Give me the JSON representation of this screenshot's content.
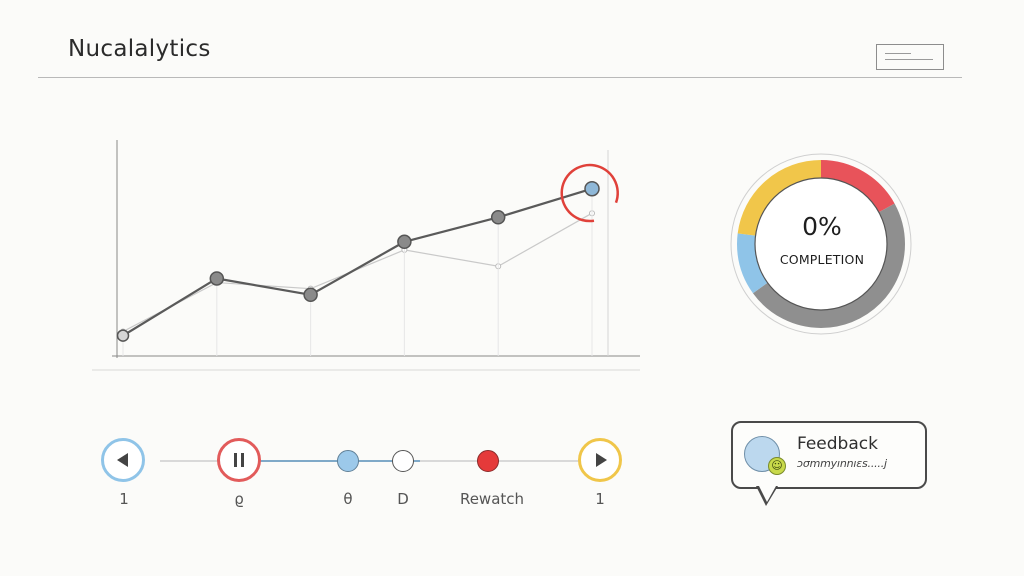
{
  "header": {
    "app_title": "Nucalalytics"
  },
  "chart_data": {
    "type": "line",
    "title": "",
    "xlabel": "",
    "ylabel": "",
    "x": [
      1,
      2,
      3,
      4,
      5,
      6
    ],
    "series": [
      {
        "values": [
          10,
          38,
          30,
          56,
          68,
          82
        ],
        "highlight_last": true
      }
    ],
    "ghost_series": [
      {
        "values": [
          12,
          36,
          33,
          52,
          44,
          70
        ]
      }
    ],
    "ylim": [
      0,
      100
    ],
    "grid": false,
    "colors": {
      "line": "#5a5a5a",
      "point_fill": "#8a8a8a",
      "highlight_ring": "#e0413a",
      "highlight_point": "#8fb8d8"
    }
  },
  "donut": {
    "value": "0%",
    "caption": "COMPLETION",
    "segments": [
      {
        "color": "#e8535a",
        "fraction": 0.17
      },
      {
        "color": "#8f8f8f",
        "fraction": 0.48
      },
      {
        "color": "#8fc4e8",
        "fraction": 0.12
      },
      {
        "color": "#f1c64a",
        "fraction": 0.23
      }
    ]
  },
  "playback": {
    "controls": [
      {
        "icon": "rewind-icon",
        "label": "1",
        "ring": "#8fc4e8"
      },
      {
        "icon": "pause-icon",
        "label": "ϱ",
        "ring": "#e25b5b"
      },
      {
        "icon": "marker-blue",
        "label": "θ",
        "fill": "#9cc9ea"
      },
      {
        "icon": "marker-empty",
        "label": "D",
        "fill": "#ffffff"
      },
      {
        "icon": "marker-red",
        "label": "Rewatch",
        "fill": "#e53a3a"
      },
      {
        "icon": "play-icon",
        "label": "1",
        "ring": "#f0c64a"
      }
    ],
    "progress": 0.45
  },
  "feedback": {
    "title": "Feedback",
    "text": "ɔσmmyınnıɛs.....j"
  }
}
